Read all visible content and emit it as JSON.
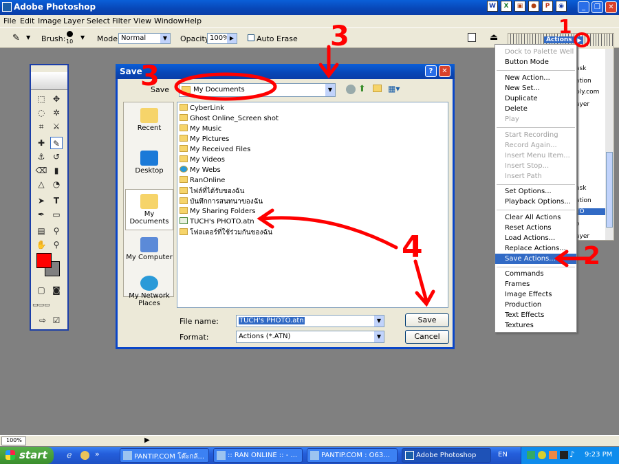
{
  "app": {
    "title": "Adobe Photoshop",
    "quick_icons": [
      "W",
      "X",
      "▣",
      "●",
      "P",
      "◉",
      "✕"
    ]
  },
  "menubar": [
    "File",
    "Edit",
    "Image",
    "Layer",
    "Select",
    "Filter",
    "View",
    "Window",
    "Help"
  ],
  "options": {
    "brush_label": "Brush:",
    "brush_size": "10",
    "mode_label": "Mode:",
    "mode_value": "Normal",
    "opacity_label": "Opacity:",
    "opacity_value": "100%",
    "auto_erase_label": "Auto Erase"
  },
  "dialog": {
    "title": "Save",
    "save_in_label": "Save",
    "location": "My Documents",
    "places": [
      "Recent",
      "Desktop",
      "My Documents",
      "My Computer",
      "My Network Places"
    ],
    "files": [
      "CyberLink",
      "Ghost Online_Screen shot",
      "My Music",
      "My Pictures",
      "My Received Files",
      "My Videos",
      "My Webs",
      "RanOnline",
      "ไฟล์ที่ได้รับของฉัน",
      "บันทึกการสนทนาของฉัน",
      "My Sharing Folders",
      "TUCH's PHOTO.atn",
      "โฟลเดอร์ที่ใช้ร่วมกันของฉัน"
    ],
    "filename_label": "File name:",
    "filename_value": "TUCH's PHOTO.atn",
    "format_label": "Format:",
    "format_value": "Actions (*.ATN)",
    "save_button": "Save",
    "cancel_button": "Cancel"
  },
  "actions_palette": {
    "tab": "Actions",
    "right_items": [
      "ask",
      "ation",
      "ply.com",
      "ayer",
      "ask",
      "ation",
      "TO",
      "o",
      "ayer"
    ]
  },
  "actions_menu": {
    "groups": [
      [
        {
          "label": "Dock to Palette Well",
          "disabled": true
        },
        {
          "label": "Button Mode",
          "disabled": false
        }
      ],
      [
        {
          "label": "New Action...",
          "disabled": false
        },
        {
          "label": "New Set...",
          "disabled": false
        },
        {
          "label": "Duplicate",
          "disabled": false
        },
        {
          "label": "Delete",
          "disabled": false
        },
        {
          "label": "Play",
          "disabled": true
        }
      ],
      [
        {
          "label": "Start Recording",
          "disabled": true
        },
        {
          "label": "Record Again...",
          "disabled": true
        },
        {
          "label": "Insert Menu Item...",
          "disabled": true
        },
        {
          "label": "Insert Stop...",
          "disabled": true
        },
        {
          "label": "Insert Path",
          "disabled": true
        }
      ],
      [
        {
          "label": "Set Options...",
          "disabled": false
        },
        {
          "label": "Playback Options...",
          "disabled": false
        }
      ],
      [
        {
          "label": "Clear All Actions",
          "disabled": false
        },
        {
          "label": "Reset Actions",
          "disabled": false
        },
        {
          "label": "Load Actions...",
          "disabled": false
        },
        {
          "label": "Replace Actions...",
          "disabled": false
        },
        {
          "label": "Save Actions...",
          "disabled": false,
          "highlighted": true
        }
      ],
      [
        {
          "label": "Commands",
          "disabled": false
        },
        {
          "label": "Frames",
          "disabled": false
        },
        {
          "label": "Image Effects",
          "disabled": false
        },
        {
          "label": "Production",
          "disabled": false
        },
        {
          "label": "Text Effects",
          "disabled": false
        },
        {
          "label": "Textures",
          "disabled": false
        }
      ]
    ]
  },
  "status": {
    "zoom": "100%"
  },
  "taskbar": {
    "start": "start",
    "tasks": [
      {
        "label": "PANTIP.COM โต๊ะกลั...",
        "active": false
      },
      {
        "label": ":: RAN ONLINE :: - ...",
        "active": false
      },
      {
        "label": "PANTIP.COM : O63...",
        "active": false
      },
      {
        "label": "Adobe Photoshop",
        "active": true
      }
    ],
    "lang": "EN",
    "clock": "9:23 PM"
  },
  "annotations": [
    "1",
    "2",
    "3",
    "3",
    "4"
  ],
  "colors": {
    "accent": "#0a46c8",
    "highlight": "#316ac5",
    "annotation": "#ff0000",
    "foreground": "#ff0000",
    "background": "#808080"
  }
}
